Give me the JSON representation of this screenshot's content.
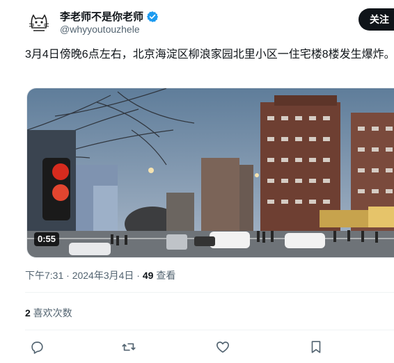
{
  "author": {
    "display_name": "李老师不是你老师",
    "handle": "@whyyoutouzhele"
  },
  "follow_label": "关注",
  "tweet": {
    "text": "3月4日傍晚6点左右，北京海淀区柳浪家园北里小区一住宅楼8楼发生爆炸。"
  },
  "video": {
    "duration": "0:55"
  },
  "meta": {
    "time": "下午7:31 · 2024年3月4日 · ",
    "views": "49",
    "views_label": " 查看"
  },
  "likes": {
    "count": "2",
    "label": " 喜欢次数"
  },
  "colors": {
    "verified": "#1d9bf0",
    "text_secondary": "#536471",
    "follow_bg": "#0f1419"
  },
  "icons": [
    "reply-icon",
    "retweet-icon",
    "like-icon",
    "bookmark-icon"
  ]
}
